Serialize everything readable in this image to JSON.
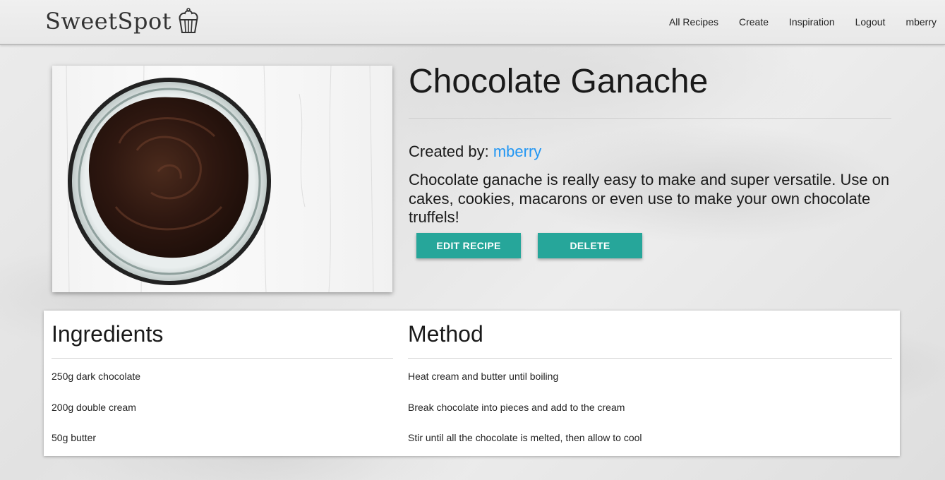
{
  "brand": {
    "name": "SweetSpot",
    "icon": "cupcake-icon"
  },
  "nav": {
    "links": [
      "All Recipes",
      "Create",
      "Inspiration",
      "Logout",
      "mberry"
    ]
  },
  "recipe": {
    "title": "Chocolate Ganache",
    "created_by_label": "Created by:",
    "author": "mberry",
    "description": "Chocolate ganache is really easy to make and super versatile. Use on cakes, cookies, macarons or even use to make your own chocolate truffels!",
    "image": "bowl-of-chocolate-ganache"
  },
  "actions": {
    "edit_label": "EDIT RECIPE",
    "delete_label": "DELETE"
  },
  "ingredients": {
    "heading": "Ingredients",
    "items": [
      "250g dark chocolate",
      "200g double cream",
      "50g butter"
    ]
  },
  "method": {
    "heading": "Method",
    "steps": [
      "Heat cream and butter until boiling",
      "Break chocolate into pieces and add to the cream",
      "Stir until all the chocolate is melted, then allow to cool"
    ]
  },
  "colors": {
    "accent": "#26a69a",
    "link": "#2196f3",
    "text": "#1a1a1a"
  }
}
